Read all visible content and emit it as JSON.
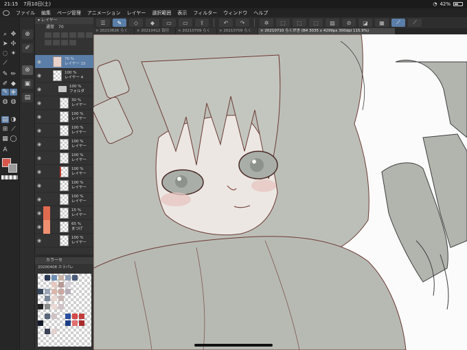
{
  "status": {
    "time": "21:15",
    "date": "7月10日(土)",
    "battery": "42%"
  },
  "menu": [
    "ファイル",
    "編集",
    "ページ管理",
    "アニメーション",
    "レイヤー",
    "選択範囲",
    "表示",
    "フィルター",
    "ウィンドウ",
    "ヘルプ"
  ],
  "tabs": [
    "20210626 らく",
    "20210412 百行",
    "20210709 らく",
    "20210709 らく",
    "20210710 らくがき (B4 3035 x 4299px 300dpi 115.9%)"
  ],
  "layer_panel": {
    "title": "レイヤー",
    "blend_mode": "通常",
    "opacity": "70",
    "layers": [
      {
        "opacity": "70 %",
        "name": "レイヤー 15",
        "type": "layer",
        "selected": true
      },
      {
        "opacity": "100 %",
        "name": "レイヤー 4",
        "type": "layer"
      },
      {
        "opacity": "100 %",
        "name": "フォルダ",
        "type": "folder"
      },
      {
        "opacity": "30 %",
        "name": "レイヤー",
        "type": "layer"
      },
      {
        "opacity": "100 %",
        "name": "レイヤー",
        "type": "layer"
      },
      {
        "opacity": "100 %",
        "name": "レイヤー",
        "type": "layer"
      },
      {
        "opacity": "100 %",
        "name": "レイヤー",
        "type": "layer"
      },
      {
        "opacity": "100 %",
        "name": "レイヤー",
        "type": "layer"
      },
      {
        "opacity": "100 %",
        "name": "レイヤー",
        "type": "layer"
      },
      {
        "opacity": "100 %",
        "name": "レイヤー",
        "type": "layer"
      },
      {
        "opacity": "100 %",
        "name": "レイヤー",
        "type": "layer"
      },
      {
        "opacity": "15 %",
        "name": "レイヤー",
        "type": "layer",
        "color_tag": "#e06a4f"
      },
      {
        "opacity": "65 %",
        "name": "まつげ",
        "type": "layer",
        "color_tag": "#f09070"
      },
      {
        "opacity": "100 %",
        "name": "レイヤー",
        "type": "layer"
      }
    ]
  },
  "color_panel": {
    "title": "カラーセ",
    "set_name": "20200408 カラパレ"
  },
  "colors": {
    "main": "#d8574a",
    "sub": "#9a9a9a",
    "accent": "#5a7ea8"
  }
}
